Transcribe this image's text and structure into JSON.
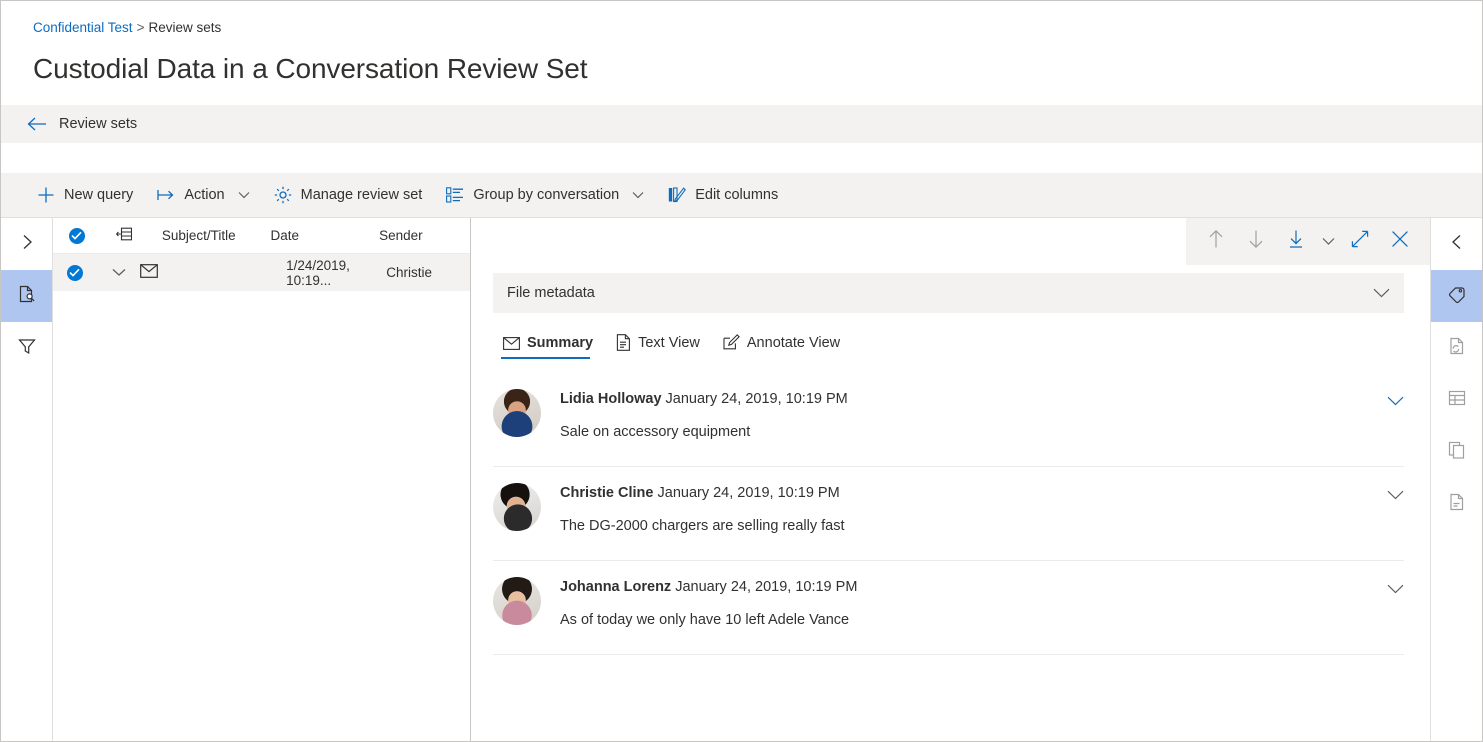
{
  "breadcrumb": {
    "root": "Confidential Test",
    "separator": ">",
    "current": "Review sets"
  },
  "page_title": "Custodial Data in a Conversation Review Set",
  "back_bar": {
    "label": "Review sets",
    "icon": "arrow-left-icon"
  },
  "command_bar": {
    "items": [
      {
        "label": "New query",
        "icon": "plus-icon",
        "chevron": false
      },
      {
        "label": "Action",
        "icon": "action-arrow-icon",
        "chevron": true
      },
      {
        "label": "Manage review set",
        "icon": "gear-icon",
        "chevron": false
      },
      {
        "label": "Group by conversation",
        "icon": "group-list-icon",
        "chevron": true
      },
      {
        "label": "Edit columns",
        "icon": "edit-columns-icon",
        "chevron": false
      }
    ]
  },
  "left_rail": {
    "items": [
      {
        "name": "expand-panel",
        "icon": "chevron-right-icon",
        "active": false
      },
      {
        "name": "document-search",
        "icon": "document-search-icon",
        "active": true
      },
      {
        "name": "filter",
        "icon": "filter-funnel-icon",
        "active": false
      }
    ]
  },
  "right_rail": {
    "items": [
      {
        "name": "collapse-panel",
        "icon": "chevron-left-icon",
        "active": false
      },
      {
        "name": "tags",
        "icon": "tag-icon",
        "active": true
      },
      {
        "name": "near-duplicates",
        "icon": "document-refresh-icon",
        "active": false
      },
      {
        "name": "table-view",
        "icon": "table-grid-icon",
        "active": false
      },
      {
        "name": "duplicates",
        "icon": "copy-documents-icon",
        "active": false
      },
      {
        "name": "email-threads",
        "icon": "document-thread-icon",
        "active": false
      }
    ]
  },
  "list": {
    "columns": [
      {
        "key": "select",
        "label": "",
        "icon": "check-circle-icon"
      },
      {
        "key": "attachments",
        "label": "",
        "icon": "collapse-list-icon"
      },
      {
        "key": "subject",
        "label": "Subject/Title"
      },
      {
        "key": "date",
        "label": "Date"
      },
      {
        "key": "sender",
        "label": "Sender"
      }
    ],
    "rows": [
      {
        "selected": true,
        "expand_icon": "chevron-down-icon",
        "type_icon": "envelope-icon",
        "subject": "",
        "date": "1/24/2019, 10:19...",
        "sender": "Christie"
      }
    ]
  },
  "detail": {
    "toolbar": [
      {
        "name": "previous-item",
        "icon": "arrow-up-icon",
        "state": "disabled"
      },
      {
        "name": "next-item",
        "icon": "arrow-down-icon",
        "state": "disabled"
      },
      {
        "name": "download",
        "icon": "download-icon",
        "state": "enabled"
      },
      {
        "name": "download-options",
        "icon": "chevron-down-icon",
        "state": "enabled"
      },
      {
        "name": "expand-pane",
        "icon": "expand-diagonal-icon",
        "state": "enabled"
      },
      {
        "name": "close-pane",
        "icon": "close-icon",
        "state": "enabled"
      }
    ],
    "metadata_bar": {
      "label": "File metadata",
      "icon": "chevron-down-icon"
    },
    "tabs": [
      {
        "label": "Summary",
        "icon": "envelope-icon",
        "active": true
      },
      {
        "label": "Text View",
        "icon": "text-document-icon",
        "active": false
      },
      {
        "label": "Annotate View",
        "icon": "annotate-pen-icon",
        "active": false
      }
    ],
    "messages": [
      {
        "sender": "Lidia Holloway",
        "timestamp": "January 24, 2019, 10:19 PM",
        "body": "Sale on accessory equipment",
        "chevron": "chevron-down-icon",
        "chevron_color": "#0f6cbd",
        "avatar": "photo-lidia-holloway"
      },
      {
        "sender": "Christie Cline",
        "timestamp": "January 24, 2019, 10:19 PM",
        "body": "The DG-2000 chargers are selling really fast",
        "chevron": "chevron-down-icon",
        "chevron_color": "#605e5c",
        "avatar": "photo-christie-cline"
      },
      {
        "sender": "Johanna Lorenz",
        "timestamp": "January 24, 2019, 10:19 PM",
        "body": "As of today we only have 10 left Adele Vance",
        "chevron": "chevron-down-icon",
        "chevron_color": "#605e5c",
        "avatar": "photo-johanna-lorenz"
      }
    ]
  },
  "colors": {
    "accent_blue": "#0f6cbd",
    "selection_blue": "#0078d4",
    "rail_active": "#aec6f0",
    "bar_gray": "#f3f2f1",
    "row_selected": "#f3f2f1",
    "text_primary": "#323130",
    "text_secondary": "#605e5c"
  }
}
